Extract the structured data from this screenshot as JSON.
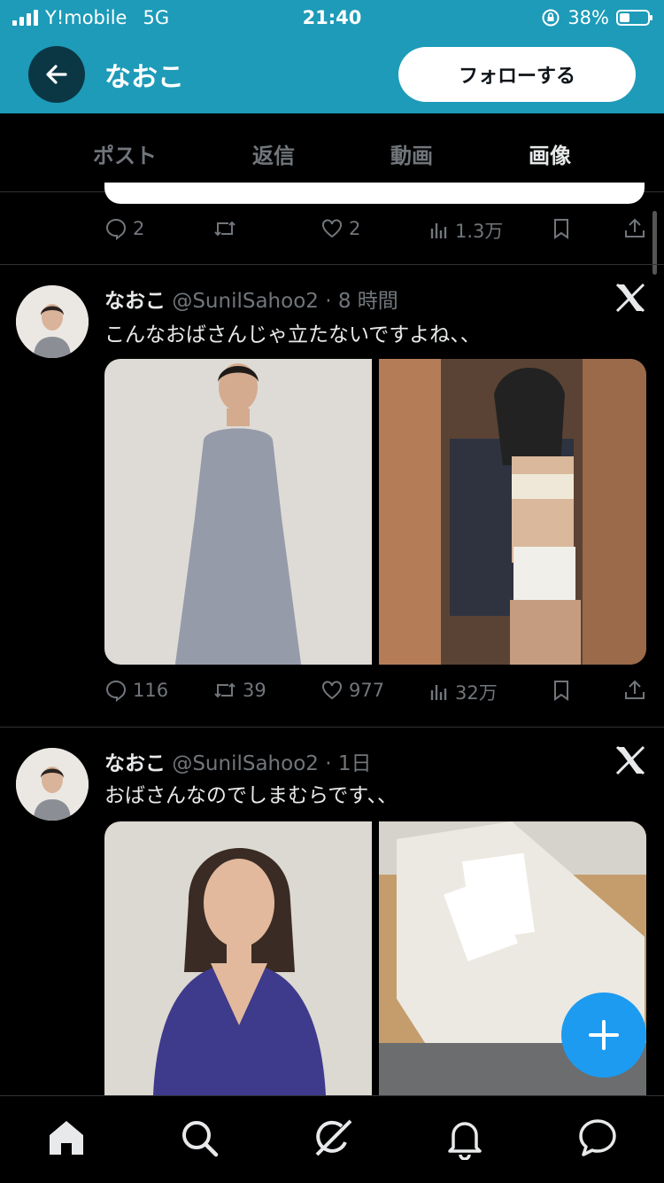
{
  "status_bar": {
    "carrier": "Y!mobile",
    "network": "5G",
    "time": "21:40",
    "battery": "38%",
    "battery_level": 0.38
  },
  "header": {
    "title": "なおこ",
    "follow_label": "フォローする"
  },
  "tabs": [
    {
      "label": "ポスト",
      "active": false
    },
    {
      "label": "返信",
      "active": false
    },
    {
      "label": "動画",
      "active": false
    },
    {
      "label": "画像",
      "active": true
    }
  ],
  "tweets": [
    {
      "stats": {
        "replies": "2",
        "reposts": "",
        "likes": "2",
        "views": "1.3万"
      }
    },
    {
      "name": "なおこ",
      "handle": "@SunilSahoo2",
      "time": "· 8 時間",
      "text": "こんなおばさんじゃ立たないですよね、、",
      "stats": {
        "replies": "116",
        "reposts": "39",
        "likes": "977",
        "views": "32万"
      }
    },
    {
      "name": "なおこ",
      "handle": "@SunilSahoo2",
      "time": "· 1日",
      "text": "おばさんなのでしまむらです、、"
    }
  ],
  "colors": {
    "accent": "#1d9bf0",
    "header_bg": "#1d9bb8",
    "background": "#000000"
  }
}
